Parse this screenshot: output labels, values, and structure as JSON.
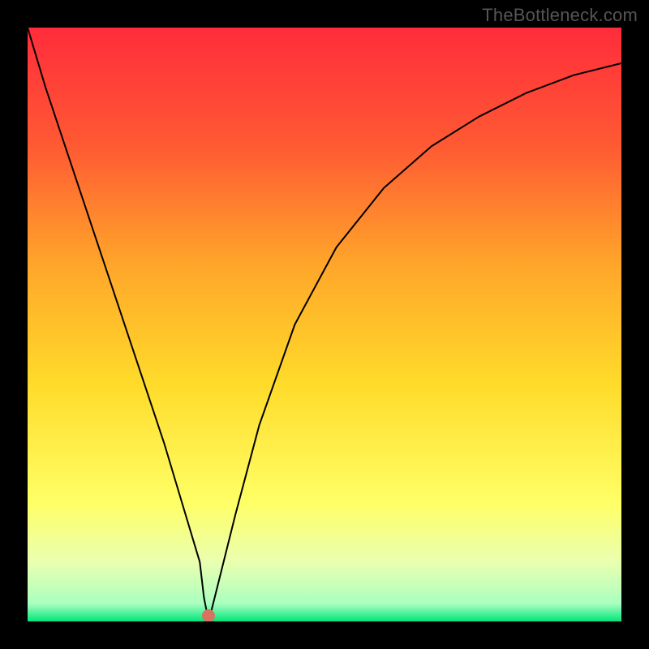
{
  "watermark": "TheBottleneck.com",
  "chart_data": {
    "type": "line",
    "title": "",
    "xlabel": "",
    "ylabel": "",
    "xlim": [
      0,
      100
    ],
    "ylim": [
      0,
      100
    ],
    "gradient_stops": [
      {
        "offset": 0,
        "color": "#ff2c3b"
      },
      {
        "offset": 20,
        "color": "#ff5a33"
      },
      {
        "offset": 40,
        "color": "#ffa62a"
      },
      {
        "offset": 60,
        "color": "#ffdb2a"
      },
      {
        "offset": 80,
        "color": "#ffff66"
      },
      {
        "offset": 90,
        "color": "#eaffb0"
      },
      {
        "offset": 97,
        "color": "#aaffc0"
      },
      {
        "offset": 100,
        "color": "#00e67a"
      }
    ],
    "series": [
      {
        "name": "bottleneck-curve",
        "x": [
          0,
          3,
          7,
          11,
          15,
          19,
          23,
          26,
          29,
          29.7,
          30.5,
          32,
          35,
          39,
          45,
          52,
          60,
          68,
          76,
          84,
          92,
          100
        ],
        "y": [
          100,
          90,
          78,
          66,
          54,
          42,
          30,
          20,
          10,
          4,
          0,
          6,
          18,
          33,
          50,
          63,
          73,
          80,
          85,
          89,
          92,
          94
        ]
      }
    ],
    "marker": {
      "x": 30.5,
      "y": 1.0
    }
  }
}
